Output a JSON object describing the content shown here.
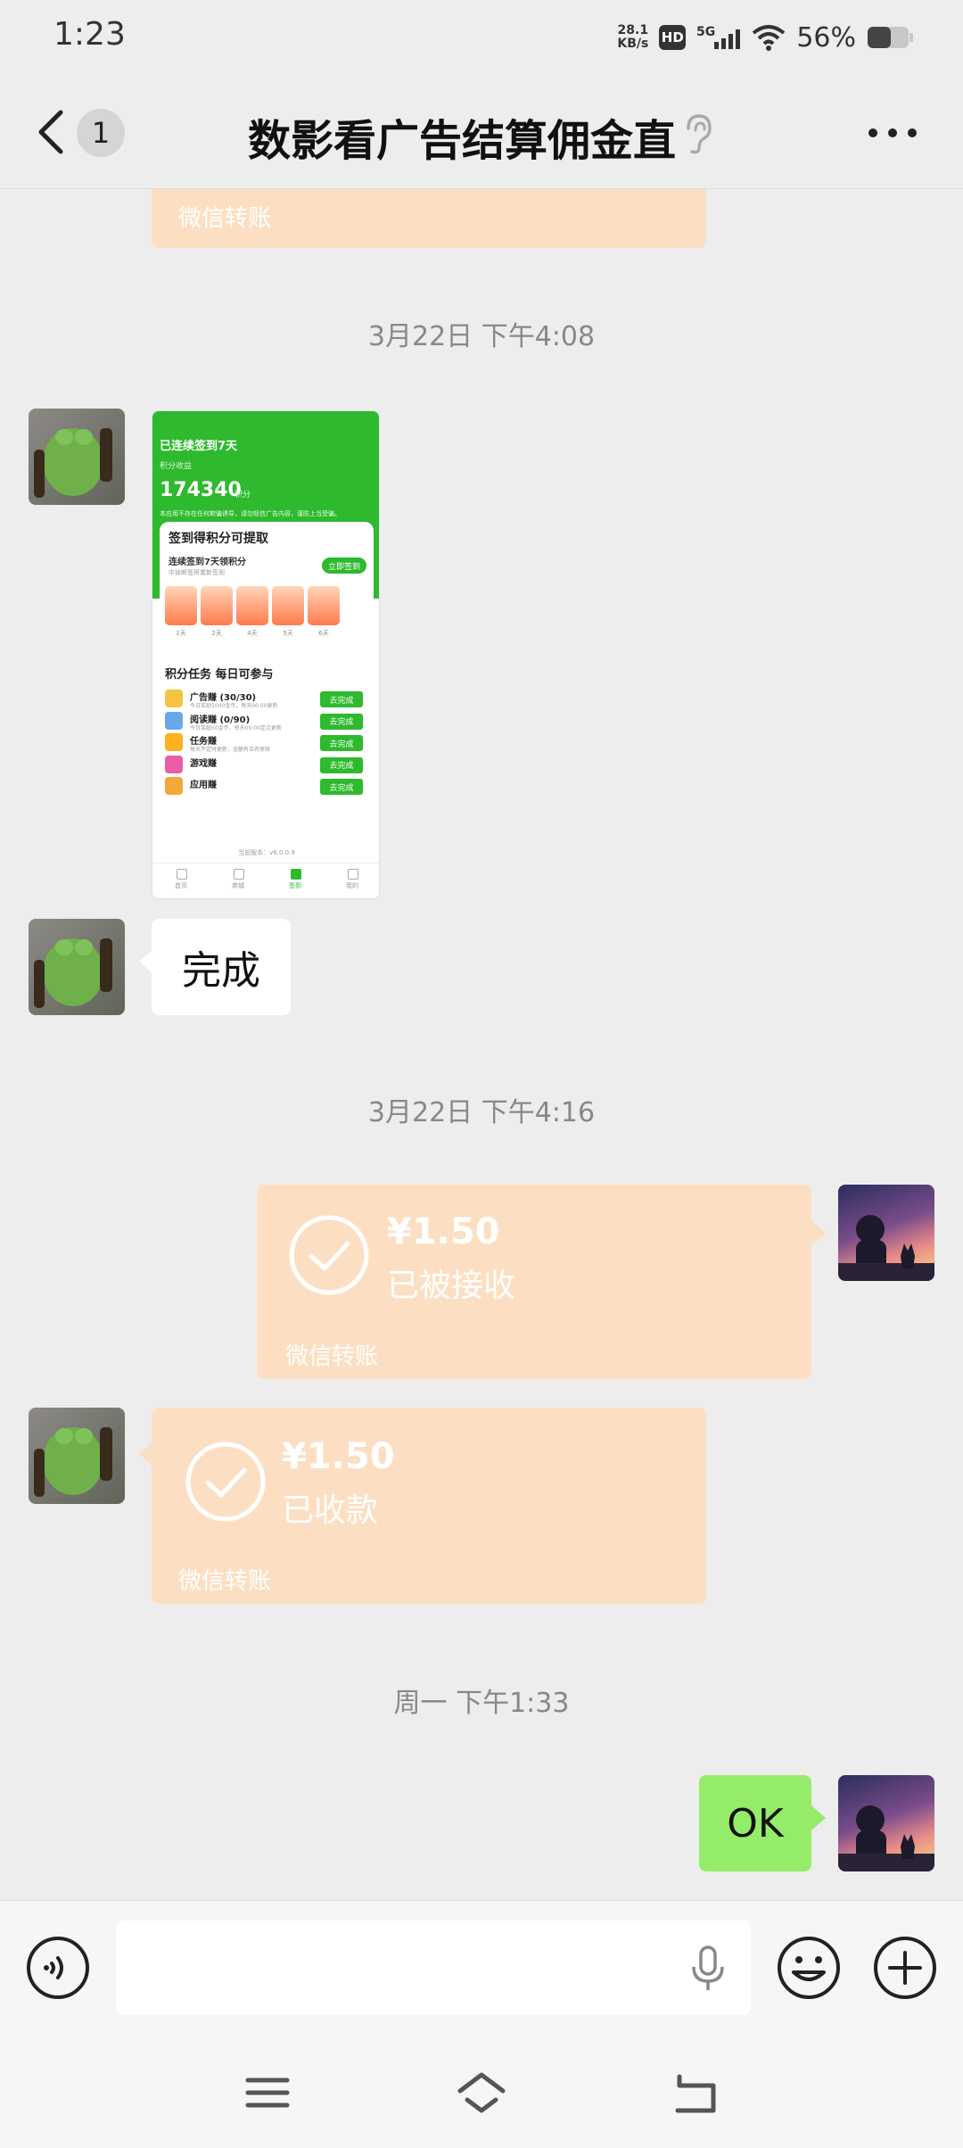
{
  "status_bar": {
    "time": "1:23",
    "net_speed_value": "28.1",
    "net_speed_unit": "KB/s",
    "hd_label": "HD",
    "network": "5G",
    "battery_percent": "56%",
    "battery_level": 0.56
  },
  "header": {
    "unread_count": "1",
    "title": "数影看广告结算佣金直"
  },
  "messages": {
    "top_partial_transfer_footer": "微信转账",
    "ts1": "3月22日 下午4:08",
    "ts2": "3月22日 下午4:16",
    "ts3": "周一 下午1:33",
    "reply_done": "完成",
    "transfer_sent": {
      "amount": "¥1.50",
      "status": "已被接收",
      "footer": "微信转账"
    },
    "transfer_received": {
      "amount": "¥1.50",
      "status": "已收款",
      "footer": "微信转账"
    },
    "reply_ok": "OK"
  },
  "screenshot_card": {
    "streak": "已连续签到7天",
    "points_label": "积分收益",
    "points": "174340",
    "points_unit": "积分",
    "note": "本应用不存在任何欺骗诱导，请勿轻信广告内容，谨防上当受骗。",
    "card_title": "签到得积分可提取",
    "card_sub": "连续签到7天领积分",
    "card_sub2": "中途断签将重新签到",
    "sign_button": "立即签到",
    "days": [
      "1天",
      "2天",
      "4天",
      "5天",
      "6天"
    ],
    "tasks_title": "积分任务 每日可参与",
    "tasks": [
      {
        "name": "广告赚 (30/30)",
        "desc": "今日奖励1000金币，每天00:00更新",
        "button": "去完成",
        "color": "#f5c542"
      },
      {
        "name": "阅读赚 (0/90)",
        "desc": "今日奖励50金币，每天00:00定点更新",
        "button": "去完成",
        "color": "#6aa7e8"
      },
      {
        "name": "任务赚",
        "desc": "每天不定时更新，金额有且有审核",
        "button": "去完成",
        "color": "#ffb020"
      },
      {
        "name": "游戏赚",
        "desc": "",
        "button": "去完成",
        "color": "#e85fa6"
      },
      {
        "name": "应用赚",
        "desc": "",
        "button": "去完成",
        "color": "#f2a93b"
      }
    ],
    "version": "当前版本：v6.0.0.9",
    "nav": [
      "首页",
      "商城",
      "签到",
      "我的"
    ]
  },
  "colors": {
    "wechat_green": "#95ec69",
    "transfer_bg": "#fcdfc2",
    "app_green": "#2eb92e"
  },
  "icons": [
    "back-icon",
    "ear-icon",
    "more-icon",
    "check-circle-icon",
    "voice-icon",
    "mic-icon",
    "emoji-icon",
    "plus-icon",
    "menu-icon",
    "home-icon",
    "return-icon"
  ]
}
